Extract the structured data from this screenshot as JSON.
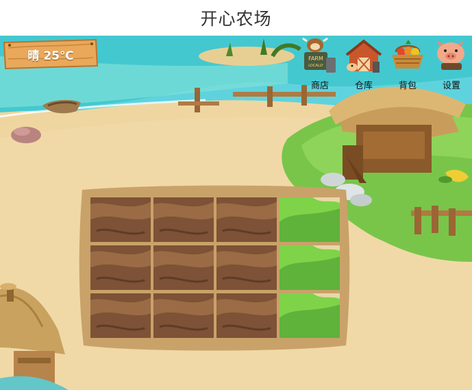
{
  "page": {
    "title": "开心农场"
  },
  "weather": {
    "text": "晴 25℃"
  },
  "menu": {
    "shop": {
      "label": "商店",
      "icon": "farm-cow-sign-icon"
    },
    "warehouse": {
      "label": "仓库",
      "icon": "barn-icon"
    },
    "backpack": {
      "label": "背包",
      "icon": "fruit-basket-icon"
    },
    "settings": {
      "label": "设置",
      "icon": "pig-icon"
    }
  },
  "shop_sign": {
    "line1": "FARM",
    "line2": "LOCALLY"
  },
  "plots": {
    "rows": [
      [
        "soil",
        "soil",
        "soil",
        "grass"
      ],
      [
        "soil",
        "soil",
        "soil",
        "grass"
      ],
      [
        "soil",
        "soil",
        "soil",
        "grass"
      ]
    ]
  },
  "colors": {
    "soil": "#7d5236",
    "grass": "#7ed348",
    "sea": "#3fcad0",
    "sand": "#eed5a0",
    "wood": "#e9a85a"
  }
}
